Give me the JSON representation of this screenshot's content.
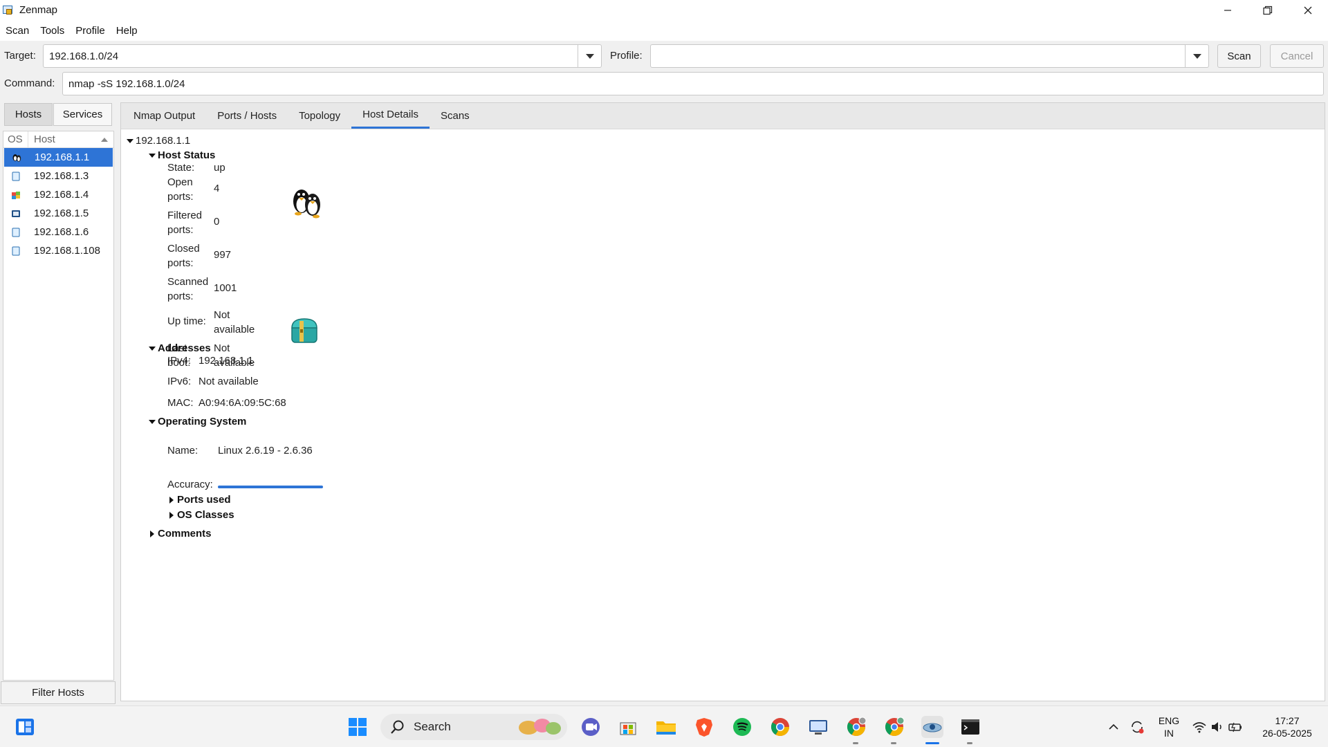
{
  "window": {
    "title": "Zenmap",
    "controls": [
      "minimize",
      "restore",
      "close"
    ]
  },
  "menu": [
    "Scan",
    "Tools",
    "Profile",
    "Help"
  ],
  "toolbar": {
    "target_label": "Target:",
    "target_value": "192.168.1.0/24",
    "profile_label": "Profile:",
    "profile_value": "",
    "scan_button": "Scan",
    "cancel_button": "Cancel",
    "command_label": "Command:",
    "command_value": "nmap -sS 192.168.1.0/24"
  },
  "left_panel": {
    "tabs": [
      "Hosts",
      "Services"
    ],
    "active_tab": "Hosts",
    "columns": [
      "OS",
      "Host"
    ],
    "hosts": [
      {
        "ip": "192.168.1.1",
        "os_icon": "linux-penguin-icon",
        "selected": true
      },
      {
        "ip": "192.168.1.3",
        "os_icon": "unknown-os-icon",
        "selected": false
      },
      {
        "ip": "192.168.1.4",
        "os_icon": "windows-os-icon",
        "selected": false
      },
      {
        "ip": "192.168.1.5",
        "os_icon": "device-os-icon",
        "selected": false
      },
      {
        "ip": "192.168.1.6",
        "os_icon": "unknown-os-icon",
        "selected": false
      },
      {
        "ip": "192.168.1.108",
        "os_icon": "unknown-os-icon",
        "selected": false
      }
    ],
    "filter_button": "Filter Hosts"
  },
  "tabs": [
    "Nmap Output",
    "Ports / Hosts",
    "Topology",
    "Host Details",
    "Scans"
  ],
  "active_tab": "Host Details",
  "details": {
    "host": "192.168.1.1",
    "host_status": {
      "title": "Host Status",
      "state_label": "State:",
      "state": "up",
      "open_label_1": "Open",
      "open_label_2": "ports:",
      "open": "4",
      "filtered_label_1": "Filtered",
      "filtered_label_2": "ports:",
      "filtered": "0",
      "closed_label_1": "Closed",
      "closed_label_2": "ports:",
      "closed": "997",
      "scanned_label_1": "Scanned",
      "scanned_label_2": "ports:",
      "scanned": "1001",
      "uptime_label": "Up time:",
      "uptime_1": "Not",
      "uptime_2": "available",
      "lastboot_label_1": "Last",
      "lastboot_label_2": "boot:",
      "lastboot_1": "Not",
      "lastboot_2": "available"
    },
    "addresses": {
      "title": "Addresses",
      "ipv4_label": "IPv4:",
      "ipv4": "192.168.1.1",
      "ipv6_label": "IPv6:",
      "ipv6": "Not available",
      "mac_label": "MAC:",
      "mac": "A0:94:6A:09:5C:68"
    },
    "os": {
      "title": "Operating System",
      "name_label": "Name:",
      "name": "Linux 2.6.19 - 2.6.36",
      "accuracy_label": "Accuracy:",
      "accuracy_fraction": 1.0,
      "ports_used": "Ports used",
      "os_classes": "OS Classes"
    },
    "comments": "Comments"
  },
  "taskbar": {
    "search": "Search",
    "lang_1": "ENG",
    "lang_2": "IN",
    "time": "17:27",
    "date": "26-05-2025"
  },
  "colors": {
    "accent": "#2e74d6",
    "selected_row": "#2e74d6"
  }
}
